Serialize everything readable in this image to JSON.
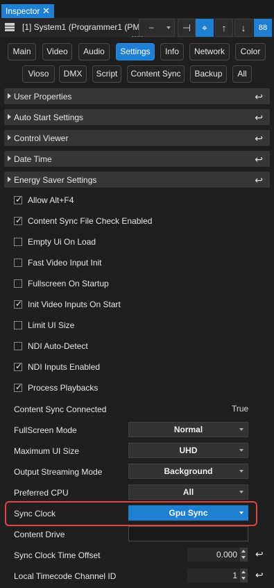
{
  "window": {
    "tab_title": "Inspector",
    "close_glyph": "✕"
  },
  "toolbar": {
    "system_label": "[1] System1 (Programmer1 (PM",
    "dash_combo": "–",
    "pin_icon": "⊣",
    "target_icon": "⌖",
    "up_icon": "↑",
    "down_icon": "↓",
    "grid_icon": "88"
  },
  "categories": {
    "main": "Main",
    "video": "Video",
    "audio": "Audio",
    "settings": "Settings",
    "info": "Info",
    "network": "Network",
    "color": "Color",
    "vioso": "Vioso",
    "dmx": "DMX",
    "script": "Script",
    "content_sync": "Content Sync",
    "backup": "Backup",
    "all": "All"
  },
  "sections": {
    "user_properties": "User Properties",
    "auto_start": "Auto Start Settings",
    "control_viewer": "Control Viewer",
    "date_time": "Date Time",
    "energy_saver": "Energy Saver Settings",
    "return_glyph": "↩"
  },
  "checks": {
    "allow_alt_f4": {
      "label": "Allow Alt+F4",
      "checked": true
    },
    "content_sync_file_check": {
      "label": "Content Sync File Check Enabled",
      "checked": true
    },
    "empty_ui": {
      "label": "Empty Ui On Load",
      "checked": false
    },
    "fast_video": {
      "label": "Fast Video Input Init",
      "checked": false
    },
    "fullscreen_startup": {
      "label": "Fullscreen On Startup",
      "checked": false
    },
    "init_video": {
      "label": "Init Video Inputs On Start",
      "checked": true
    },
    "limit_ui": {
      "label": "Limit UI Size",
      "checked": false
    },
    "ndi_autodetect": {
      "label": "NDI Auto-Detect",
      "checked": false
    },
    "ndi_inputs": {
      "label": "NDI Inputs Enabled",
      "checked": true
    },
    "process_playbacks": {
      "label": "Process Playbacks",
      "checked": true
    },
    "tick_glyph": "✓"
  },
  "props": {
    "content_sync_connected": {
      "label": "Content Sync Connected",
      "value": "True"
    },
    "fullscreen_mode": {
      "label": "FullScreen Mode",
      "value": "Normal"
    },
    "max_ui_size": {
      "label": "Maximum UI Size",
      "value": "UHD"
    },
    "output_streaming": {
      "label": "Output Streaming Mode",
      "value": "Background"
    },
    "preferred_cpu": {
      "label": "Preferred CPU",
      "value": "All"
    },
    "sync_clock": {
      "label": "Sync Clock",
      "value": "Gpu Sync"
    },
    "content_drive": {
      "label": "Content Drive",
      "value": ""
    },
    "sync_clock_offset": {
      "label": "Sync Clock Time Offset",
      "value": "0.000"
    },
    "local_timecode": {
      "label": "Local Timecode Channel ID",
      "value": "1"
    }
  },
  "colors": {
    "accent": "#1e7fd3",
    "highlight_border": "#e04444"
  }
}
